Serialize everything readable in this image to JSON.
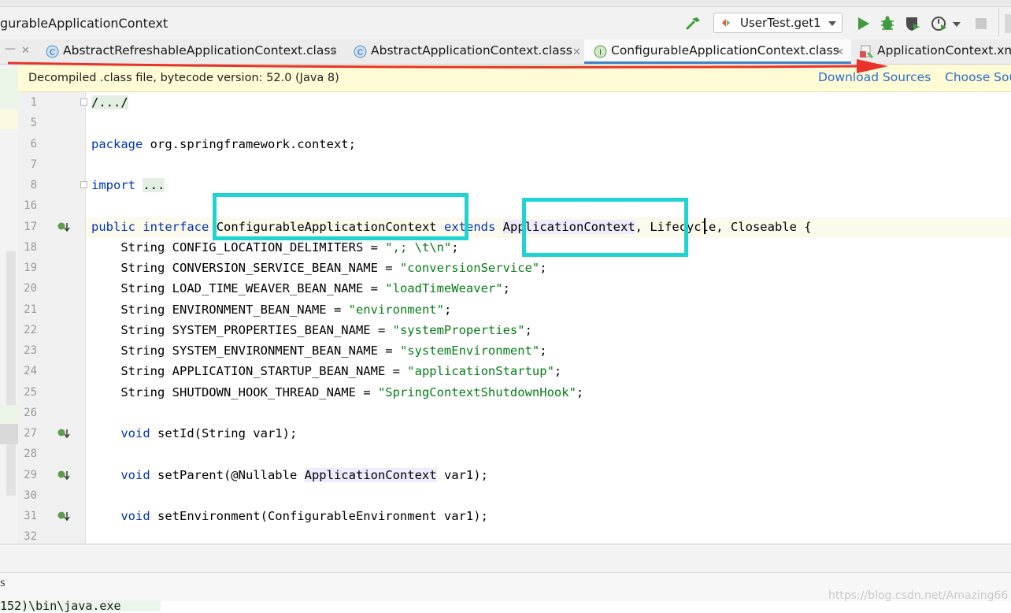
{
  "window": {
    "title": "gurableApplicationContext"
  },
  "toolbar": {
    "run_config": "UserTest.get1"
  },
  "tabs": [
    {
      "label": "AbstractRefreshableApplicationContext.class",
      "kind": "class"
    },
    {
      "label": "AbstractApplicationContext.class",
      "kind": "class"
    },
    {
      "label": "ConfigurableApplicationContext.class",
      "kind": "interface",
      "active": true
    },
    {
      "label": "ApplicationContext.xm",
      "kind": "xml"
    }
  ],
  "banner": {
    "text": "Decompiled .class file, bytecode version: 52.0 (Java 8)",
    "download_sources": "Download Sources",
    "choose_sources": "Choose Sou"
  },
  "code": {
    "line_numbers": [
      "1",
      "5",
      "6",
      "7",
      "8",
      "16",
      "17",
      "18",
      "19",
      "20",
      "21",
      "22",
      "23",
      "24",
      "25",
      "26",
      "27",
      "28",
      "29",
      "30",
      "31",
      "32"
    ],
    "l1": "/.../",
    "l6a": "package",
    "l6b": " org.springframework.context;",
    "l8a": "import",
    "l8b": "...",
    "l17_public": "public",
    "l17_interface": "interface",
    "l17_name": "ConfigurableApplicationContext",
    "l17_extends": "extends",
    "l17_parent": "ApplicationContext",
    "l17_rest": ", Lifecycle, Closeable {",
    "fields": [
      {
        "decl": "    String CONFIG_LOCATION_DELIMITERS = ",
        "value": "\",; \\t\\n\""
      },
      {
        "decl": "    String CONVERSION_SERVICE_BEAN_NAME = ",
        "value": "\"conversionService\""
      },
      {
        "decl": "    String LOAD_TIME_WEAVER_BEAN_NAME = ",
        "value": "\"loadTimeWeaver\""
      },
      {
        "decl": "    String ENVIRONMENT_BEAN_NAME = ",
        "value": "\"environment\""
      },
      {
        "decl": "    String SYSTEM_PROPERTIES_BEAN_NAME = ",
        "value": "\"systemProperties\""
      },
      {
        "decl": "    String SYSTEM_ENVIRONMENT_BEAN_NAME = ",
        "value": "\"systemEnvironment\""
      },
      {
        "decl": "    String APPLICATION_STARTUP_BEAN_NAME = ",
        "value": "\"applicationStartup\""
      },
      {
        "decl": "    String SHUTDOWN_HOOK_THREAD_NAME = ",
        "value": "\"SpringContextShutdownHook\""
      }
    ],
    "l27_kw": "void",
    "l27_rest": " setId(String var1);",
    "l29_kw": "void",
    "l29_mid": " setParent(@Nullable ",
    "l29_type": "ApplicationContext",
    "l29_end": " var1);",
    "l31_kw": "void",
    "l31_rest": " setEnvironment(ConfigurableEnvironment var1);"
  },
  "console": {
    "text": "152)\\bin\\java.exe",
    "corner": "s"
  },
  "watermark": "https://blog.csdn.net/Amazing66",
  "colors": {
    "annotation_box": "#1fd3d3",
    "annotation_arrow": "#e8322b",
    "keyword": "#0033b3",
    "string": "#067d17",
    "link": "#2a6fc9"
  }
}
